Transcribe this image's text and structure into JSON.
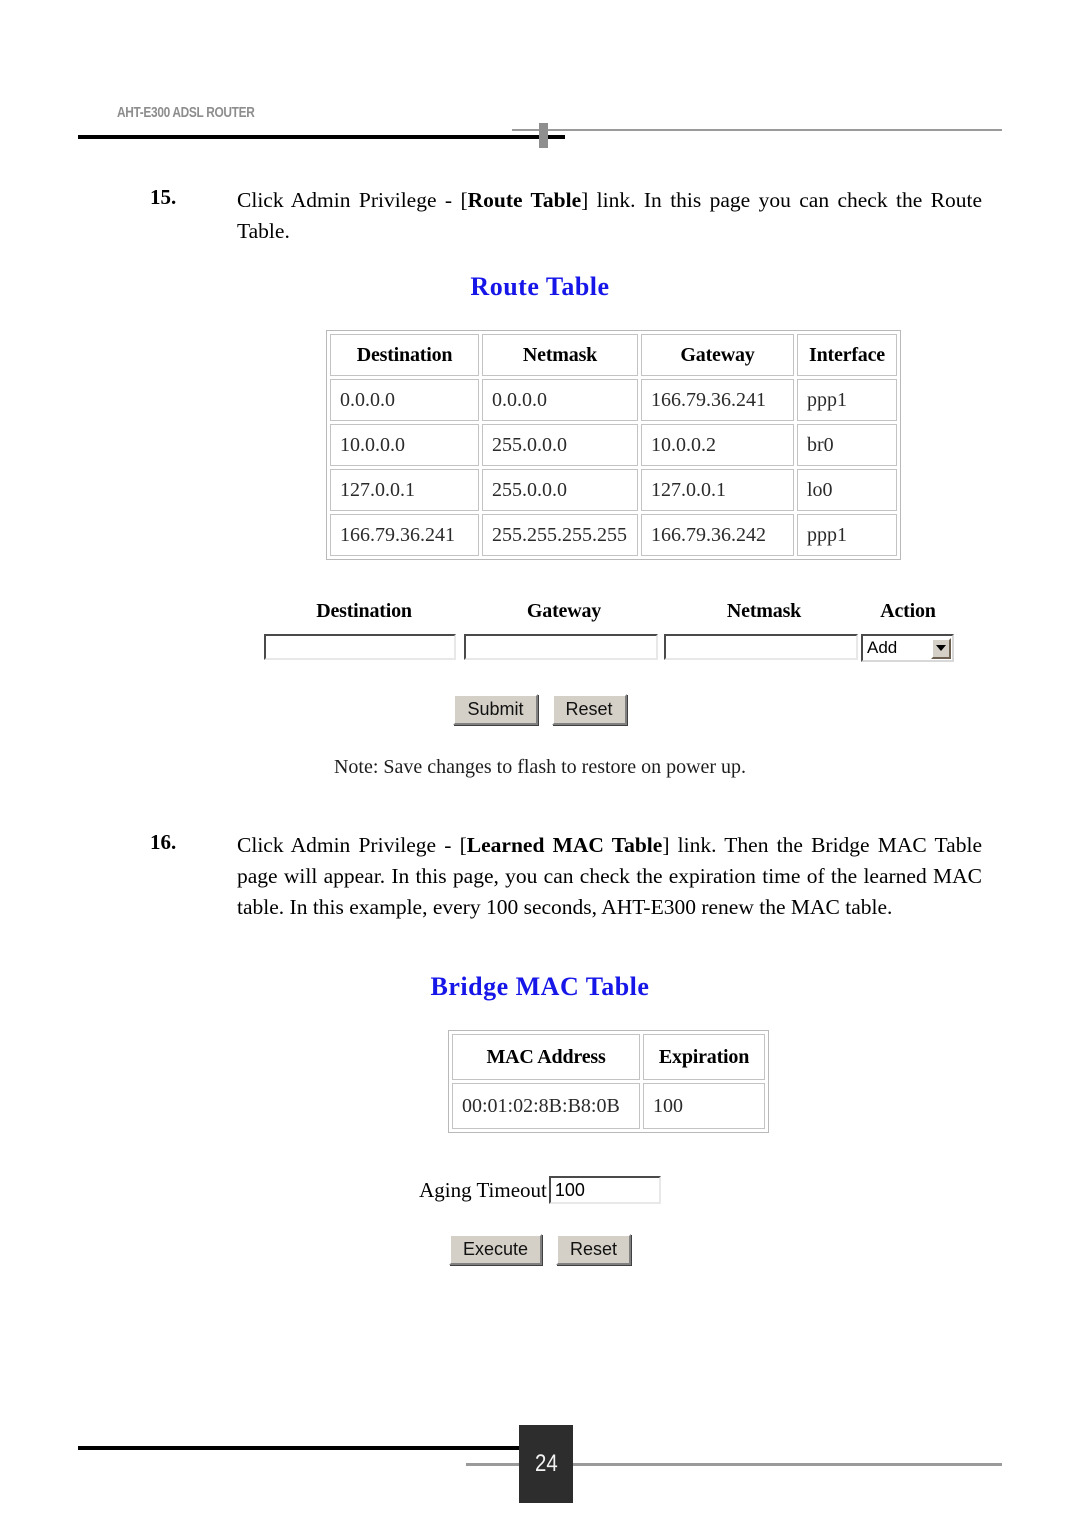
{
  "document": {
    "header_title": "AHT-E300 ADSL ROUTER",
    "page_number": "24"
  },
  "steps": [
    {
      "number": "15.",
      "text_before": "Click Admin Privilege - [",
      "bold": "Route Table",
      "text_after": "] link. In this page you can check the Route Table."
    },
    {
      "number": "16.",
      "text_before": "Click Admin Privilege - [",
      "bold": "Learned MAC Table",
      "text_after": "] link. Then the Bridge MAC Table page will appear. In this page, you can check the expiration time of the learned MAC table. In this example, every 100 seconds, AHT-E300 renew the MAC table."
    }
  ],
  "route_table_screen": {
    "heading": "Route Table",
    "table": {
      "columns": [
        "Destination",
        "Netmask",
        "Gateway",
        "Interface"
      ],
      "rows": [
        [
          "0.0.0.0",
          "0.0.0.0",
          "166.79.36.241",
          "ppp1"
        ],
        [
          "10.0.0.0",
          "255.0.0.0",
          "10.0.0.2",
          "br0"
        ],
        [
          "127.0.0.1",
          "255.0.0.0",
          "127.0.0.1",
          "lo0"
        ],
        [
          "166.79.36.241",
          "255.255.255.255",
          "166.79.36.242",
          "ppp1"
        ]
      ]
    },
    "form": {
      "labels": {
        "destination": "Destination",
        "gateway": "Gateway",
        "netmask": "Netmask",
        "action": "Action"
      },
      "destination_value": "",
      "gateway_value": "",
      "netmask_value": "",
      "action_selected": "Add"
    },
    "buttons": {
      "submit": "Submit",
      "reset": "Reset"
    },
    "note": "Note: Save changes to flash to restore on power up."
  },
  "bridge_mac_screen": {
    "heading": "Bridge MAC Table",
    "table": {
      "columns": [
        "MAC Address",
        "Expiration"
      ],
      "rows": [
        [
          "00:01:02:8B:B8:0B",
          "100"
        ]
      ]
    },
    "aging": {
      "label": "Aging Timeout",
      "value": "100"
    },
    "buttons": {
      "execute": "Execute",
      "reset": "Reset"
    }
  },
  "colors": {
    "heading_blue": "#1616e8",
    "header_gray": "#8d8d8d",
    "footer_box": "#2d2d2d",
    "button_face": "#d4d0c8"
  }
}
